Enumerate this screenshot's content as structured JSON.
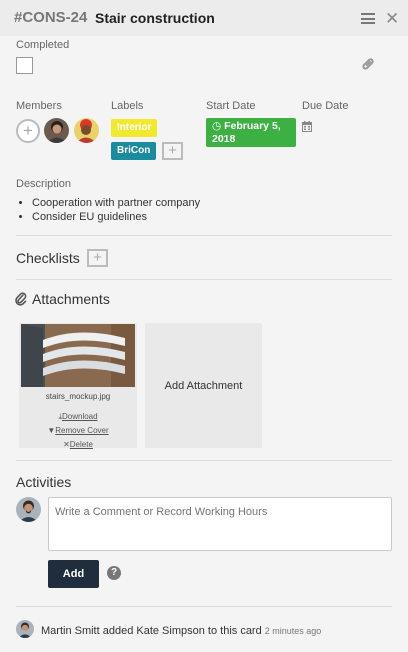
{
  "header": {
    "card_id": "#CONS-24",
    "title": "Stair construction"
  },
  "completed": {
    "label": "Completed"
  },
  "members": {
    "label": "Members"
  },
  "labels": {
    "label": "Labels",
    "items": [
      {
        "name": "Interior",
        "color": "#f2e82e"
      },
      {
        "name": "BriCon",
        "color": "#1b8b9e"
      }
    ]
  },
  "start_date": {
    "label": "Start Date",
    "line1": "February 5,",
    "line2": "2018",
    "color": "#3cb043"
  },
  "due_date": {
    "label": "Due Date"
  },
  "description": {
    "label": "Description",
    "items": [
      "Cooperation with partner company",
      "Consider EU guidelines"
    ]
  },
  "checklists": {
    "title": "Checklists"
  },
  "attachments": {
    "title": "Attachments",
    "file": {
      "name": "stairs_mockup.jpg",
      "download": "Download",
      "remove_cover": "Remove Cover",
      "delete": "Delete"
    },
    "add_label": "Add Attachment"
  },
  "activities": {
    "title": "Activities",
    "comment_placeholder": "Write a Comment or Record Working Hours",
    "add_label": "Add",
    "log": [
      {
        "text": "Martin Smitt added Kate Simpson to this card",
        "time": "2 minutes ago"
      }
    ]
  }
}
